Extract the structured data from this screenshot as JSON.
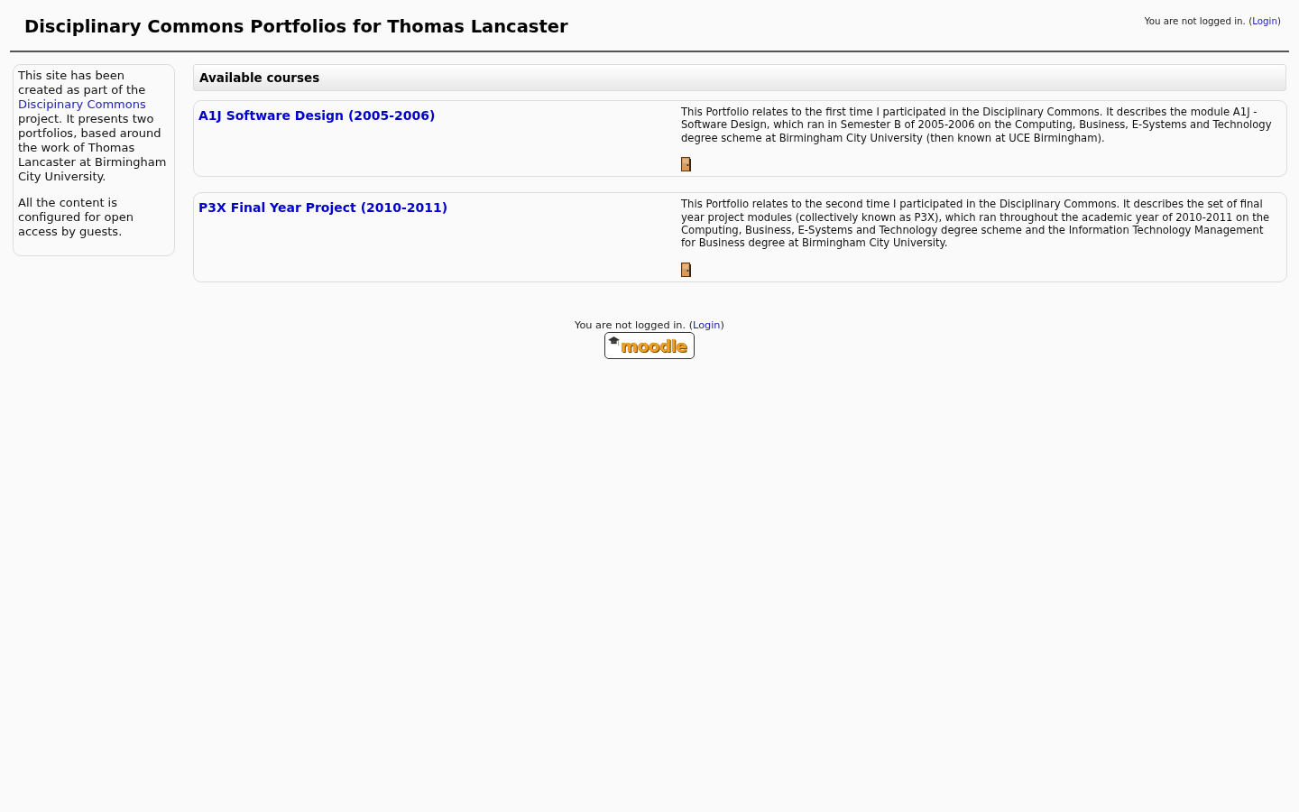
{
  "header": {
    "title": "Disciplinary Commons Portfolios for Thomas Lancaster",
    "login_info": {
      "before": "You are not logged in. (",
      "link": "Login",
      "after": ")"
    }
  },
  "sidebar": {
    "paragraphs": [
      {
        "before": "This site has been created as part of the ",
        "link": "Discipinary Commons",
        "after": " project. It presents two portfolios, based around the work of Thomas Lancaster at Birmingham City University."
      },
      {
        "text": "All the content is configured for open access by guests."
      }
    ]
  },
  "courses": {
    "heading": "Available courses",
    "items": [
      {
        "title": "A1J Software Design (2005-2006)",
        "summary": "This Portfolio relates to the first time I participated in the Disciplinary Commons. It describes the module A1J - Software Design, which ran in Semester B of 2005-2006 on the Computing, Business, E-Systems and Technology degree scheme at Birmingham City University (then known at UCE Birmingham).",
        "guest_access": true
      },
      {
        "title": "P3X Final Year Project (2010-2011)",
        "summary": "This Portfolio relates to the second time I participated in the Disciplinary Commons. It describes the set of final year project modules (collectively known as P3X), which ran throughout the academic year of 2010-2011 on the Computing, Business, E-Systems and Technology degree scheme and the Information Technology Management for Business degree at Birmingham City University.",
        "guest_access": true
      }
    ]
  },
  "footer": {
    "login_info": {
      "before": "You are not logged in. (",
      "link": "Login",
      "after": ")"
    },
    "logo_text": "moodle"
  }
}
